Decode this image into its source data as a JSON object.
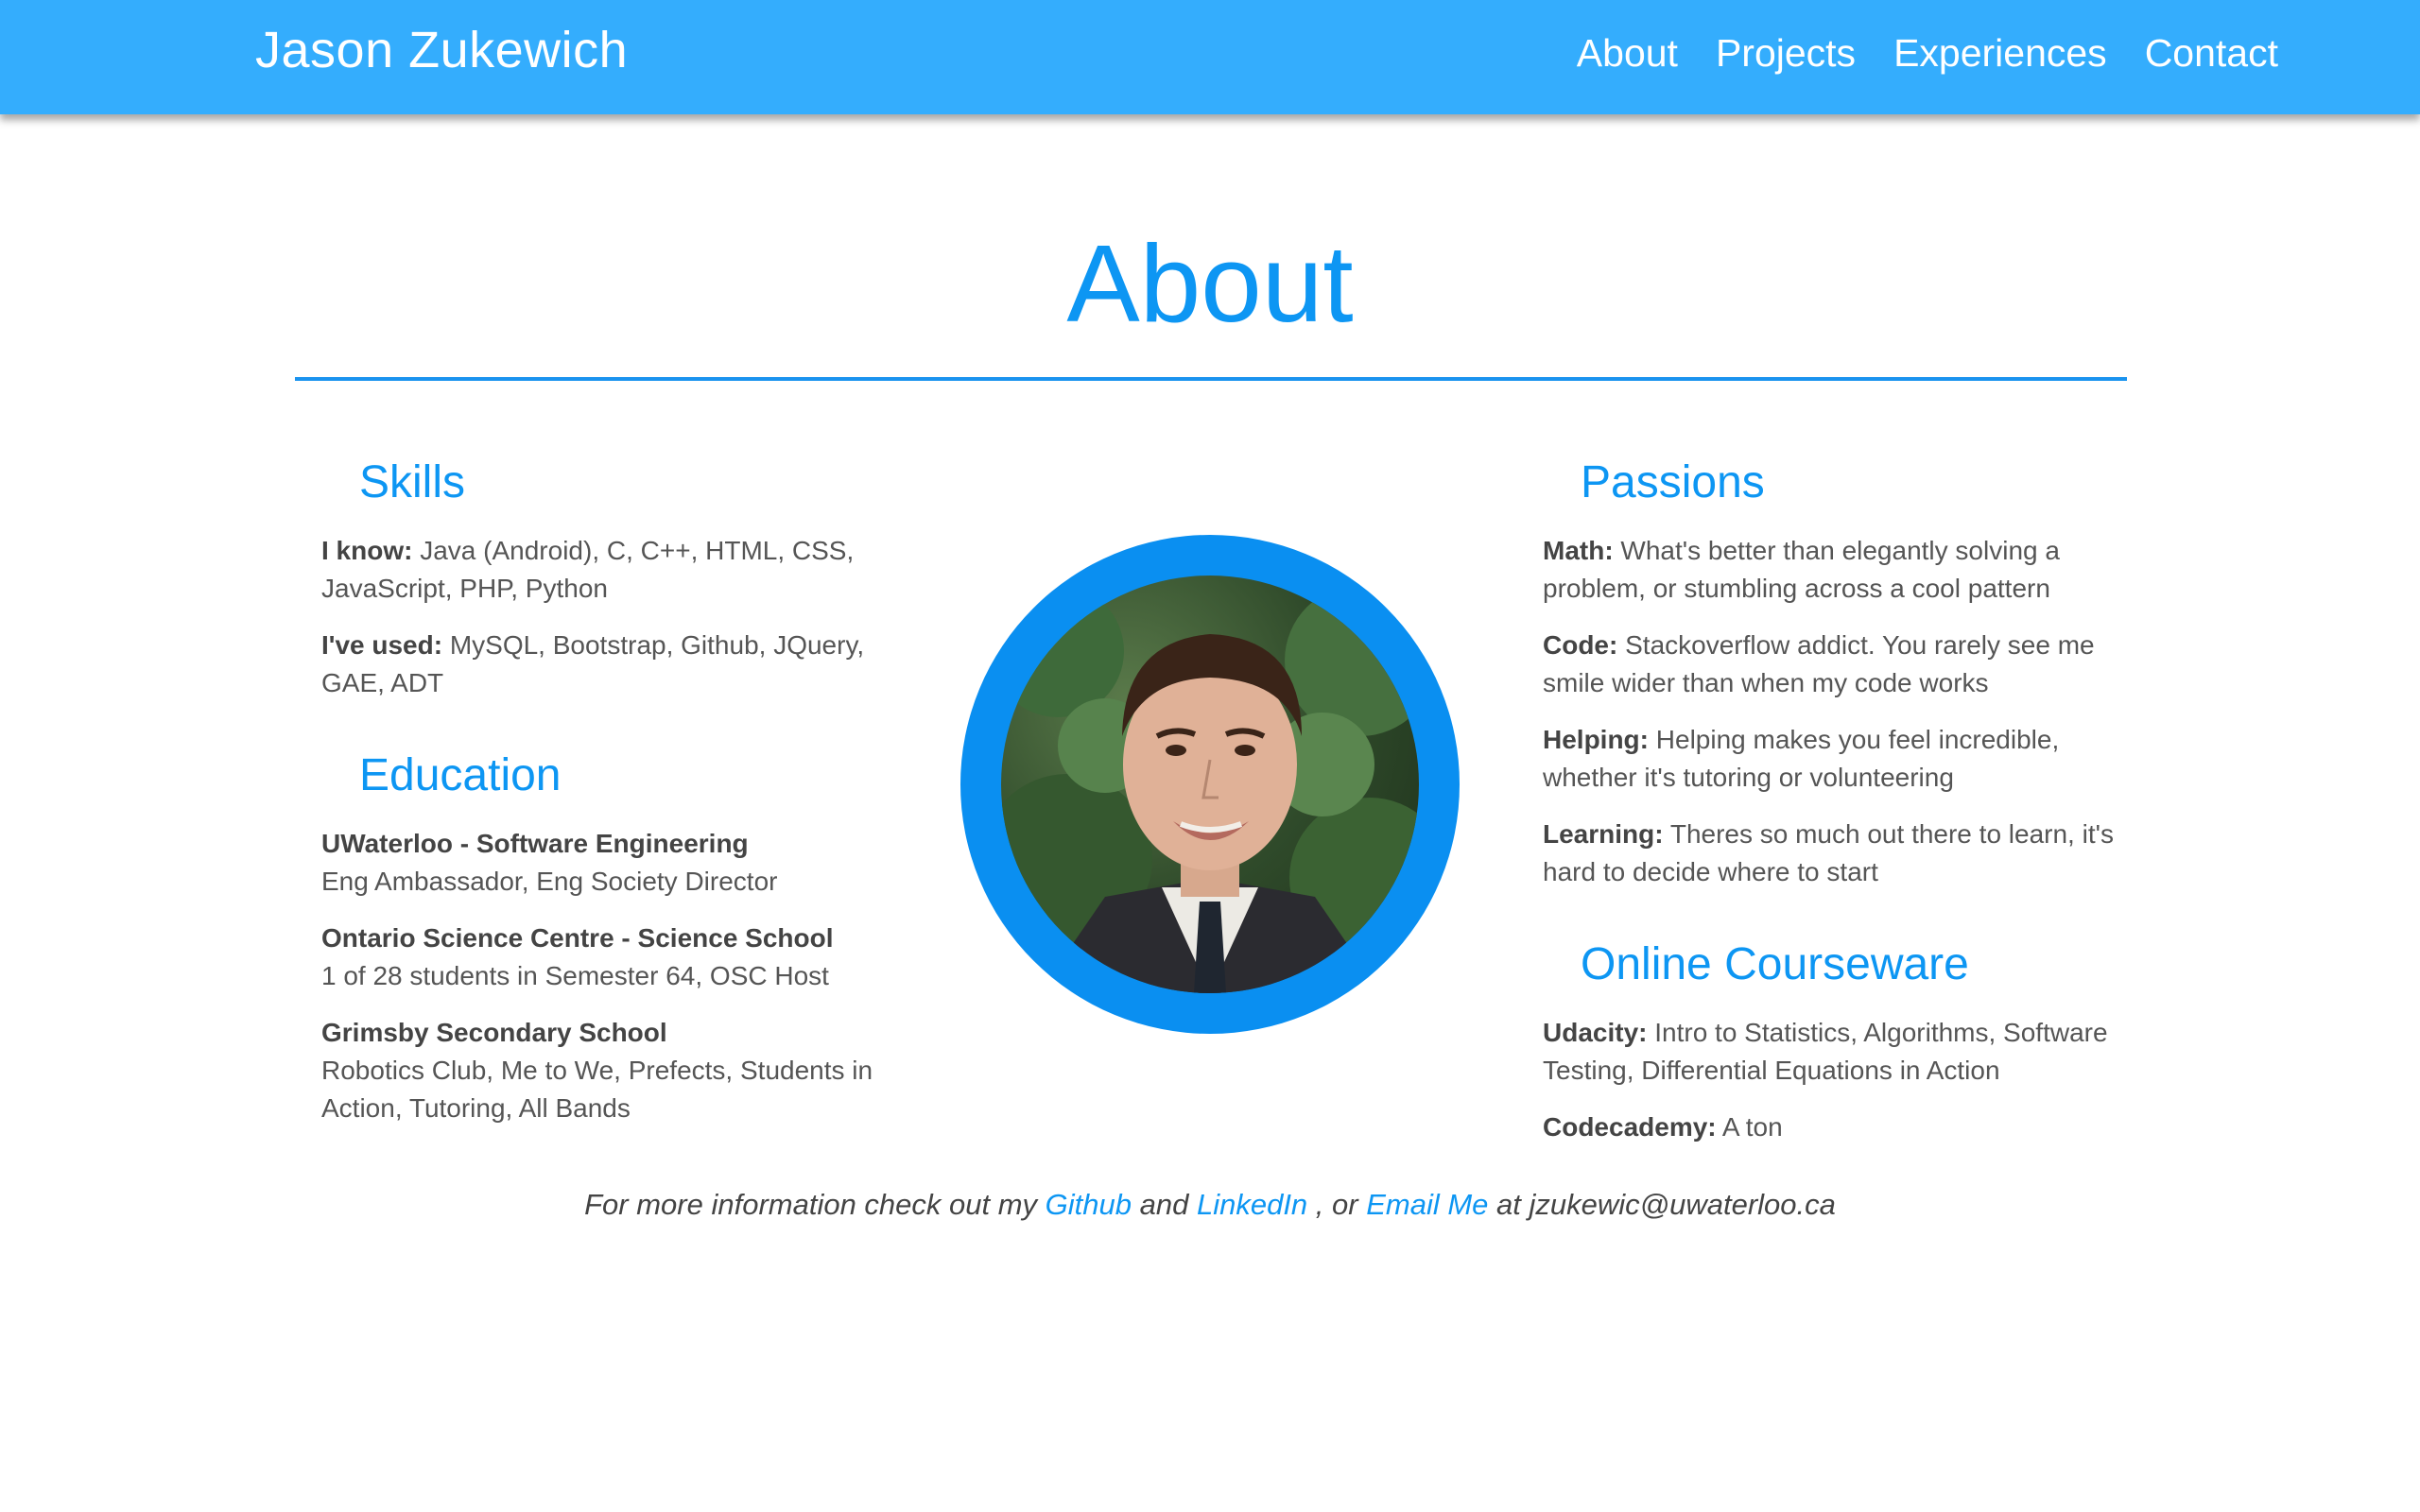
{
  "navbar": {
    "brand": "Jason Zukewich",
    "links": [
      "About",
      "Projects",
      "Experiences",
      "Contact"
    ]
  },
  "about": {
    "title": "About"
  },
  "skills": {
    "title": "Skills",
    "items": [
      {
        "label": "I know:",
        "text": " Java (Android), C, C++, HTML, CSS, JavaScript, PHP, Python"
      },
      {
        "label": "I've used:",
        "text": " MySQL, Bootstrap, Github, JQuery, GAE, ADT"
      }
    ]
  },
  "education": {
    "title": "Education",
    "items": [
      {
        "name": "UWaterloo - Software Engineering",
        "text": "Eng Ambassador, Eng Society Director"
      },
      {
        "name": "Ontario Science Centre - Science School",
        "text": "1 of 28 students in Semester 64, OSC Host"
      },
      {
        "name": "Grimsby Secondary School",
        "text": "Robotics Club, Me to We, Prefects, Students in Action, Tutoring, All Bands"
      }
    ]
  },
  "passions": {
    "title": "Passions",
    "items": [
      {
        "label": "Math:",
        "text": " What's better than elegantly solving a problem, or stumbling across a cool pattern"
      },
      {
        "label": "Code:",
        "text": " Stackoverflow addict. You rarely see me smile wider than when my code works"
      },
      {
        "label": "Helping:",
        "text": " Helping makes you feel incredible, whether it's tutoring or volunteering"
      },
      {
        "label": "Learning:",
        "text": " Theres so much out there to learn, it's hard to decide where to start"
      }
    ]
  },
  "courseware": {
    "title": "Online Courseware",
    "items": [
      {
        "label": "Udacity:",
        "text": " Intro to Statistics, Algorithms, Software Testing, Differential Equations in Action"
      },
      {
        "label": "Codecademy:",
        "text": " A ton"
      }
    ]
  },
  "footer": {
    "prefix": "For more information check out my ",
    "github": "Github",
    "and": " and ",
    "linkedin": "LinkedIn",
    "or": " , or ",
    "email": "Email Me",
    "suffix": " at jzukewic@uwaterloo.ca"
  },
  "colors": {
    "navbar": "#34adfd",
    "accent": "#0d96f3",
    "ring": "#0a8ff1"
  },
  "photo": {
    "icon": "profile-photo"
  }
}
